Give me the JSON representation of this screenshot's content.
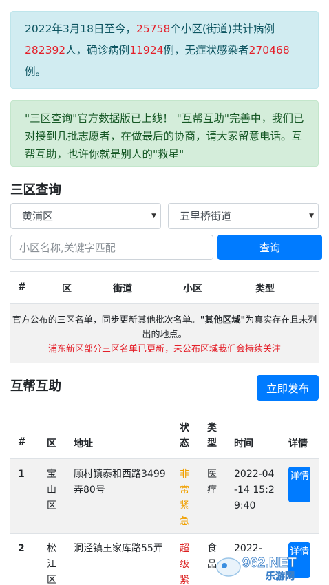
{
  "stats": {
    "prefix": "2022年3月18日至今，",
    "communities": "25758",
    "mid1": "个小区(街道)共计病例",
    "cases": "282392",
    "mid2": "人，确诊病例",
    "confirmed": "11924",
    "mid3": "例，无症状感染者",
    "asymptomatic": "270468",
    "suffix": "例。"
  },
  "announcement": "\"三区查询\"官方数据版已上线！ \"互帮互助\"完善中，我们已对接到几批志愿者，在做最后的协商，请大家留意电话。互帮互助，也许你就是别人的\"救星\"",
  "query": {
    "title": "三区查询",
    "district": "黄浦区",
    "street": "五里桥街道",
    "placeholder": "小区名称,关键字匹配",
    "search_label": "查询",
    "headers": {
      "num": "#",
      "district": "区",
      "street": "街道",
      "community": "小区",
      "type": "类型"
    },
    "notice_line1_a": "官方公布的三区名单，同步更新其他批次名单。",
    "notice_bold": "\"其他区域\"",
    "notice_line1_b": "为真实存在且未列出的地点。",
    "notice_red": "浦东新区部分三区名单已更新，未公布区域我们会持续关注"
  },
  "mutual": {
    "title": "互帮互助",
    "publish_label": "立即发布",
    "headers": {
      "num": "#",
      "district": "区",
      "address": "地址",
      "status": "状态",
      "type": "类型",
      "time": "时间",
      "detail": "详情"
    },
    "rows": [
      {
        "num": "1",
        "district": "宝山区",
        "address": "顾村镇泰和西路3499弄80号",
        "status": "非常紧急",
        "type": "医疗",
        "time": "2022-04-14 15:29:40",
        "detail": "详情"
      },
      {
        "num": "2",
        "district": "松江区",
        "address": "洞泾镇王家库路55弄",
        "status": "超级紧急",
        "type": "食品",
        "time": "2022-",
        "detail": "详情"
      }
    ]
  },
  "watermark": {
    "brand": "962.NET",
    "site": "乐游网"
  },
  "colors": {
    "primary": "#007bff",
    "info_bg": "#d1ecf1",
    "success_bg": "#d4edda",
    "highlight": "#e4202a",
    "urgent": "#f0a000",
    "critical": "#dc2020"
  }
}
